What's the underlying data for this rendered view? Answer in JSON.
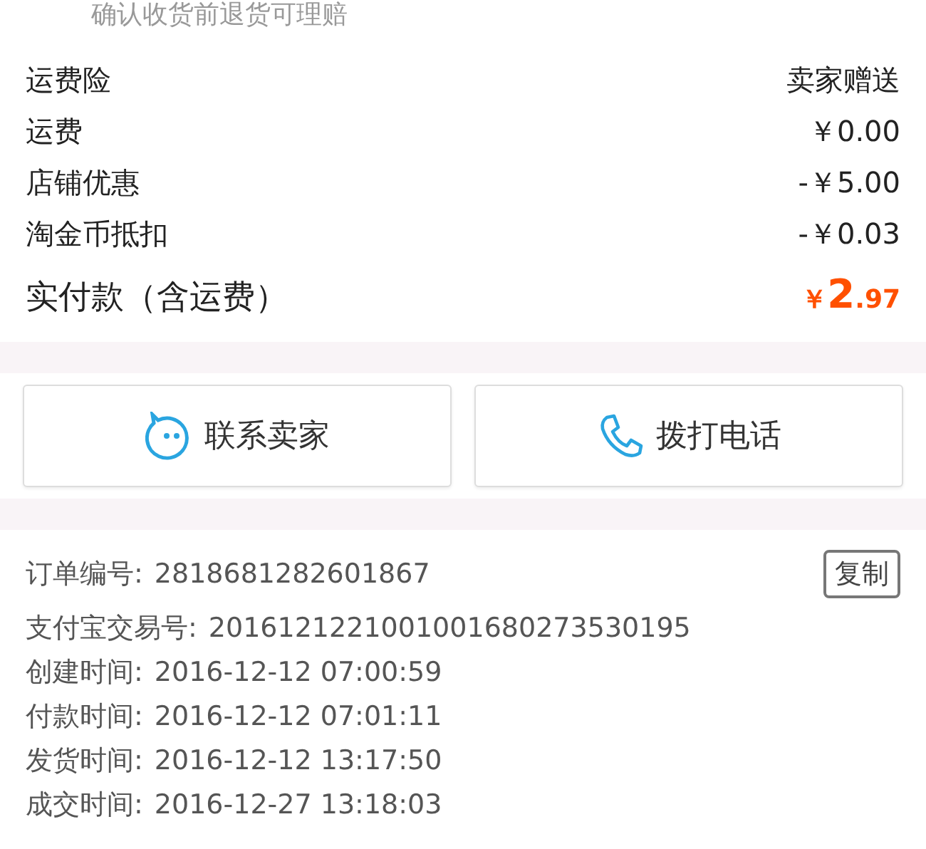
{
  "notice": "确认收货前退货可理赔",
  "fees": [
    {
      "label": "运费险",
      "value": "卖家赠送"
    },
    {
      "label": "运费",
      "value": "￥0.00"
    },
    {
      "label": "店铺优惠",
      "value": "-￥5.00"
    },
    {
      "label": "淘金币抵扣",
      "value": "-￥0.03"
    }
  ],
  "total": {
    "label": "实付款（含运费）",
    "currency": "￥",
    "integer": "2",
    "decimal": ".97"
  },
  "actions": [
    {
      "kind": "chat",
      "label": "联系卖家"
    },
    {
      "kind": "phone",
      "label": "拨打电话"
    }
  ],
  "order_info": [
    {
      "label": "订单编号:",
      "value": "2818681282601867",
      "copy_button": "复制"
    },
    {
      "label": "支付宝交易号:",
      "value": "2016121221001001680273530195"
    },
    {
      "label": "创建时间:",
      "value": "2016-12-12 07:00:59"
    },
    {
      "label": "付款时间:",
      "value": "2016-12-12 07:01:11"
    },
    {
      "label": "发货时间:",
      "value": "2016-12-12 13:17:50"
    },
    {
      "label": "成交时间:",
      "value": "2016-12-27 13:18:03"
    }
  ]
}
